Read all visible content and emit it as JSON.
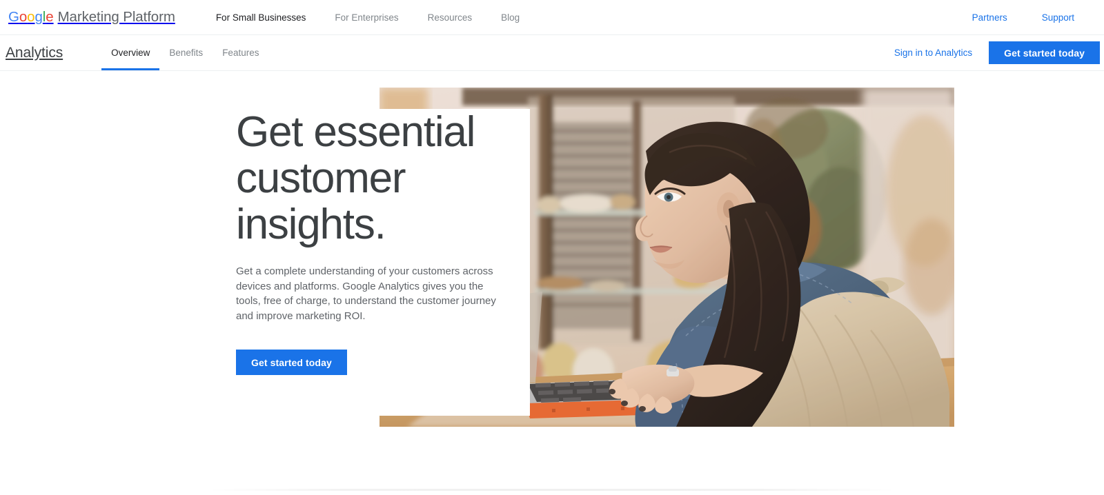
{
  "topbar": {
    "logo": {
      "google_letters": [
        "G",
        "o",
        "o",
        "g",
        "l",
        "e"
      ],
      "suffix": "Marketing Platform",
      "colors": {
        "blue": "#4285F4",
        "red": "#EA4335",
        "yellow": "#FBBC05",
        "green": "#34A853"
      }
    },
    "nav": [
      {
        "label": "For Small Businesses",
        "active": true
      },
      {
        "label": "For Enterprises",
        "active": false
      },
      {
        "label": "Resources",
        "active": false
      },
      {
        "label": "Blog",
        "active": false
      }
    ],
    "right_links": [
      {
        "label": "Partners"
      },
      {
        "label": "Support"
      }
    ]
  },
  "productbar": {
    "product_name": "Analytics",
    "tabs": [
      {
        "label": "Overview",
        "active": true
      },
      {
        "label": "Benefits",
        "active": false
      },
      {
        "label": "Features",
        "active": false
      }
    ],
    "signin_label": "Sign in to Analytics",
    "cta_label": "Get started today"
  },
  "hero": {
    "title": "Get essential customer insights.",
    "description": "Get a complete understanding of your customers across devices and platforms. Google Analytics gives you the tools, free of charge, to understand the customer journey and improve marketing ROI.",
    "cta_label": "Get started today",
    "image_alt": "Woman in denim jacket and apron typing on a laptop at a shop counter"
  },
  "theme": {
    "accent_blue": "#1a73e8",
    "link_blue": "#1a73e8",
    "heading_gray": "#3c4043",
    "body_gray": "#5f6368",
    "muted_gray": "#80868b",
    "background": "#ffffff"
  }
}
